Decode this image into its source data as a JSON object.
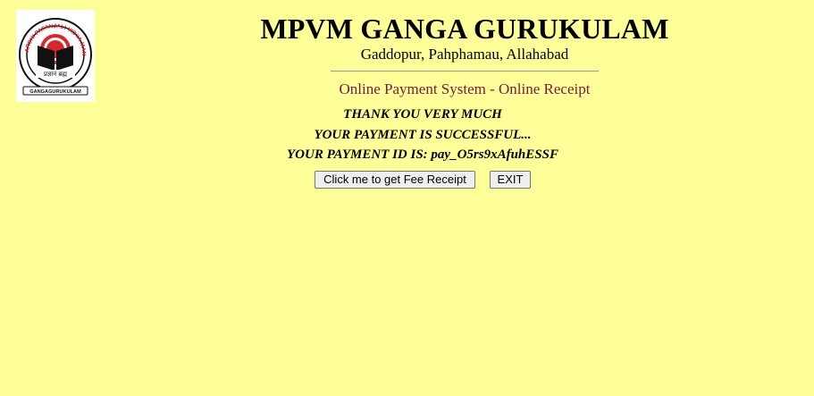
{
  "header": {
    "school_name": "MPVM GANGA GURUKULAM",
    "address": "Gaddopur, Pahphamau, Allahabad",
    "system_title": "Online Payment System - Online Receipt",
    "logo": {
      "ring_text": "MAHARSHI PATANJALI VIDYA MANDIR",
      "bottom_text": "GANGAGURUKULAM",
      "motto": "प्रज्ञानं ब्रह्म"
    }
  },
  "messages": {
    "thanks": "THANK YOU VERY MUCH",
    "success": "YOUR PAYMENT IS SUCCESSFUL...",
    "payment_id": "YOUR PAYMENT ID IS: pay_O5rs9xAfuhESSF"
  },
  "buttons": {
    "receipt": "Click me to get Fee Receipt",
    "exit": "EXIT"
  },
  "colors": {
    "background": "#ffff99",
    "title_maroon": "#7a1a3a",
    "logo_red": "#d8262e"
  }
}
